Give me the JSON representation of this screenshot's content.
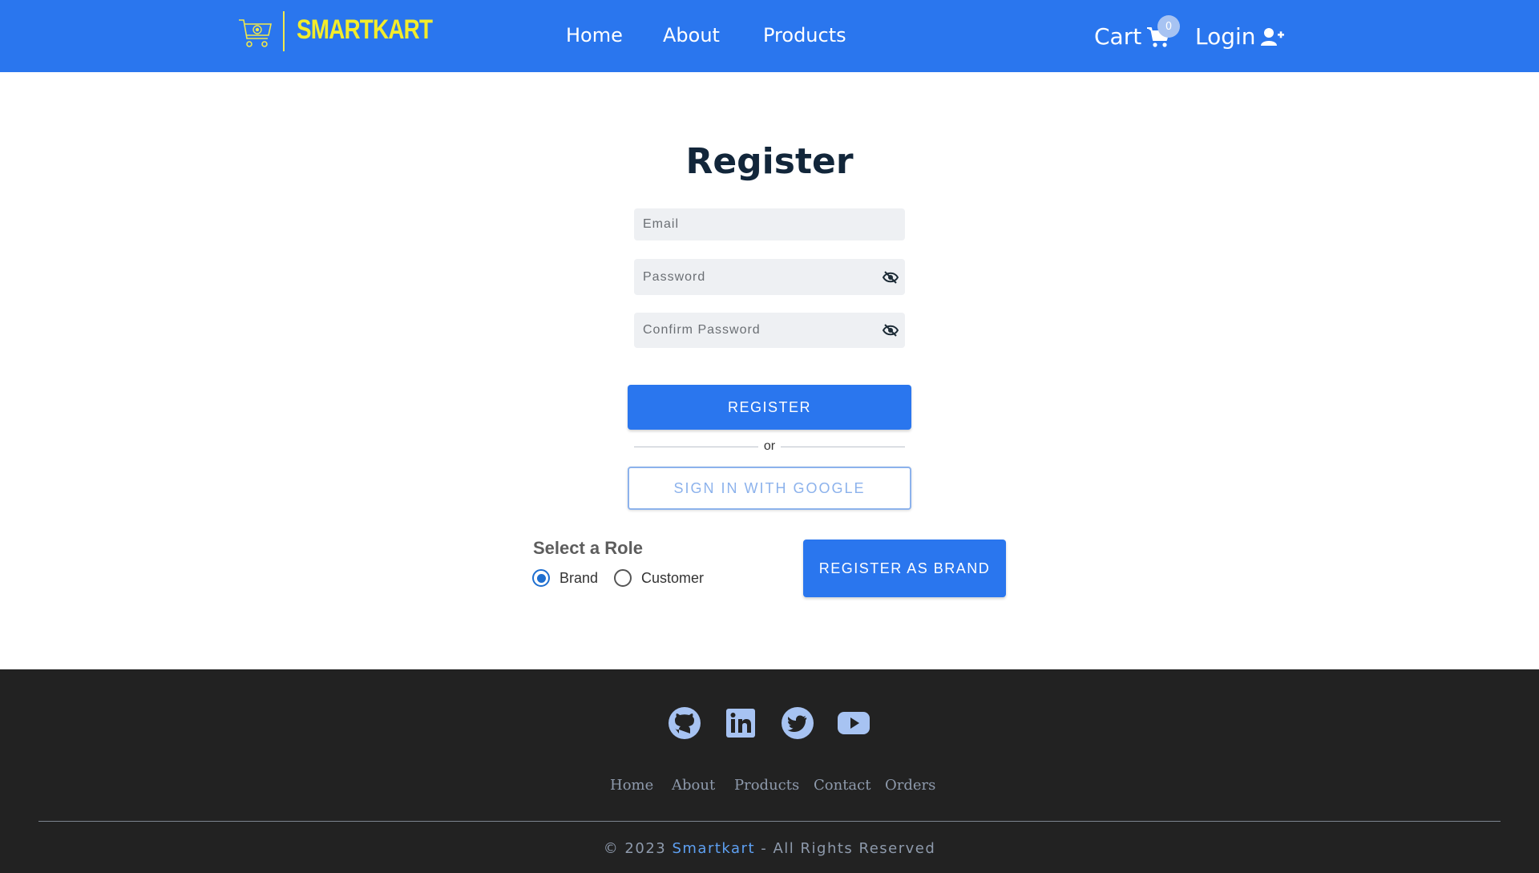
{
  "navbar": {
    "brand": "SMARTKART",
    "links": [
      "Home",
      "About",
      "Products"
    ],
    "cart_label": "Cart",
    "cart_count": "0",
    "login_label": "Login"
  },
  "form": {
    "title": "Register",
    "email_placeholder": "Email",
    "password_placeholder": "Password",
    "confirm_placeholder": "Confirm Password",
    "register_label": "REGISTER",
    "or_text": "or",
    "google_label": "SIGN IN WITH GOOGLE"
  },
  "role": {
    "title": "Select a Role",
    "options": [
      "Brand",
      "Customer"
    ],
    "selected": "Brand",
    "action_label": "REGISTER AS BRAND"
  },
  "footer": {
    "social": [
      "github-icon",
      "linkedin-icon",
      "twitter-icon",
      "youtube-icon"
    ],
    "links": [
      "Home",
      "About",
      "Products",
      "Contact",
      "Orders"
    ],
    "copyright_prefix": "© 2023",
    "copyright_brand": "Smartkart",
    "copyright_suffix": "- All Rights Reserved"
  },
  "colors": {
    "primary": "#2a76ee",
    "brand_yellow": "#f3ec2b",
    "footer_bg": "#222222",
    "social_icon": "#a7c3f2"
  }
}
